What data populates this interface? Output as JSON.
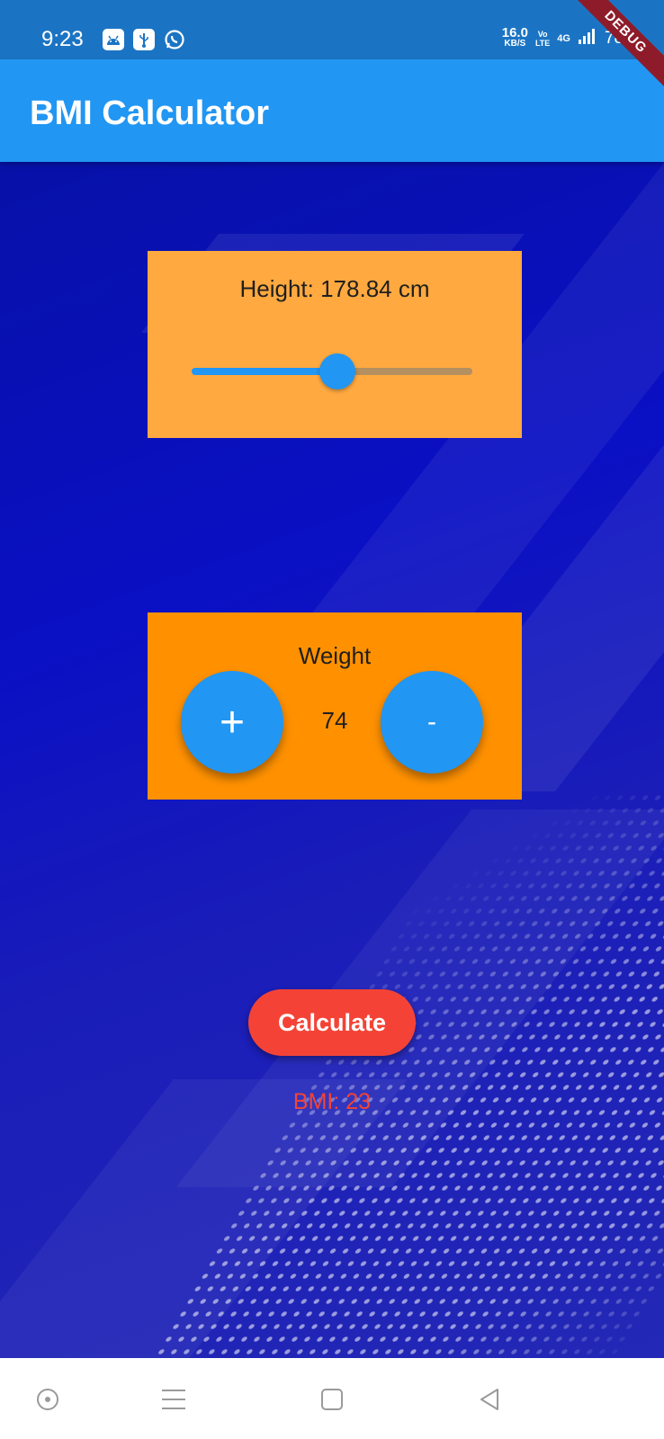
{
  "status_bar": {
    "time": "9:23",
    "net_speed_value": "16.0",
    "net_speed_unit": "KB/S",
    "volte_top": "Vo",
    "volte_bottom": "LTE",
    "network": "4G",
    "battery": "78%",
    "left_icons": [
      "android-icon",
      "usb-icon",
      "whatsapp-icon"
    ]
  },
  "debug_banner": "DEBUG",
  "app_bar": {
    "title": "BMI Calculator"
  },
  "height_card": {
    "label": "Height: 178.84 cm",
    "slider_fraction": 0.52
  },
  "weight_card": {
    "label": "Weight",
    "value": "74",
    "increment_label": "+",
    "decrement_label": "-"
  },
  "calculate_button": {
    "label": "Calculate"
  },
  "result": {
    "text": "BMI: 23"
  },
  "colors": {
    "app_bar": "#2196f3",
    "status_bar": "#1b74c3",
    "height_card": "#ffa940",
    "weight_card": "#ff9100",
    "accent": "#2196f3",
    "calculate": "#f44336",
    "result_text": "#f44336"
  },
  "nav_bar": {
    "icons": [
      "circle-dot-icon",
      "menu-icon",
      "square-icon",
      "back-triangle-icon"
    ]
  }
}
